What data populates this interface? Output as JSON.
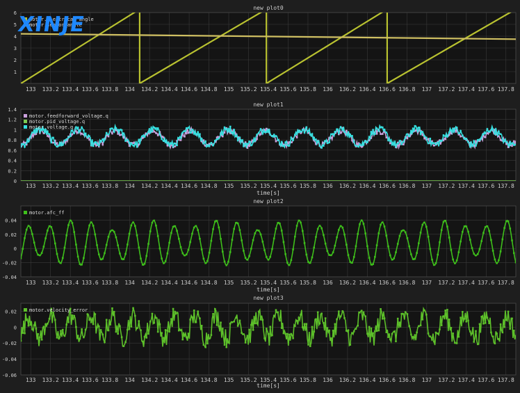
{
  "watermark": "XINJE",
  "colors": {
    "background": "#1e1e1e",
    "plot_bg": "#141414",
    "grid": "#3a3a3a",
    "text": "#cfcfcf",
    "plot0_series": [
      "#b9c230",
      "#cfbf62"
    ],
    "plot1_series": [
      "#c9a0dc",
      "#7dcc52",
      "#36e0e0"
    ],
    "plot2_series": [
      "#3ebf1b"
    ],
    "plot3_series": [
      "#5dc02a"
    ]
  },
  "chart_data": [
    {
      "type": "line",
      "title": "new plot0",
      "xlabel": "",
      "ylabel": "",
      "xlim": [
        132.9,
        137.9
      ],
      "ylim": [
        0,
        6
      ],
      "x_ticks": [
        "133",
        "133.2",
        "133.4",
        "133.6",
        "133.8",
        "134",
        "134.2",
        "134.4",
        "134.6",
        "134.8",
        "135",
        "135.2",
        "135.4",
        "135.6",
        "135.8",
        "136",
        "136.2",
        "136.4",
        "136.6",
        "136.8",
        "137",
        "137.2",
        "137.4",
        "137.6",
        "137.8"
      ],
      "y_ticks": [
        "1",
        "2",
        "3",
        "4",
        "5",
        "6"
      ],
      "grid": true,
      "legend_position": "top-left",
      "series": [
        {
          "name": "motor.electrical_angle",
          "kind": "sawtooth",
          "points": [
            [
              132.9,
              0.0
            ],
            [
              134.1,
              6.28
            ],
            [
              134.1,
              0.0
            ],
            [
              135.38,
              6.28
            ],
            [
              135.38,
              0.0
            ],
            [
              136.6,
              6.28
            ],
            [
              136.6,
              0.0
            ],
            [
              137.9,
              6.28
            ]
          ]
        },
        {
          "name": "motor.sensor_angle",
          "kind": "line",
          "points": [
            [
              132.9,
              4.2
            ],
            [
              137.9,
              3.75
            ]
          ]
        }
      ]
    },
    {
      "type": "line",
      "title": "new plot1",
      "xlabel": "time[s]",
      "ylabel": "",
      "xlim": [
        132.9,
        137.9
      ],
      "ylim": [
        0,
        1.4
      ],
      "x_ticks": [
        "133",
        "133.2",
        "133.4",
        "133.6",
        "133.8",
        "134",
        "134.2",
        "134.4",
        "134.6",
        "134.8",
        "135",
        "135.2",
        "135.4",
        "135.6",
        "135.8",
        "136",
        "136.2",
        "136.4",
        "136.6",
        "136.8",
        "137",
        "137.2",
        "137.4",
        "137.6",
        "137.8"
      ],
      "y_ticks": [
        "0",
        "0.2",
        "0.4",
        "0.6",
        "0.8",
        "1",
        "1.2",
        "1.4"
      ],
      "grid": true,
      "legend_position": "top-left",
      "series": [
        {
          "name": "motor.feedforward_voltage.q",
          "kind": "oscillating",
          "mean": 0.84,
          "amplitude": 0.14,
          "period": 0.38,
          "noise": 0.06
        },
        {
          "name": "motor.pid_voltage.q",
          "kind": "constant",
          "value": 0.0
        },
        {
          "name": "motor.voltage.q",
          "kind": "oscillating",
          "mean": 0.86,
          "amplitude": 0.15,
          "period": 0.38,
          "noise": 0.07
        }
      ]
    },
    {
      "type": "line",
      "title": "new plot2",
      "xlabel": "time[s]",
      "ylabel": "",
      "xlim": [
        132.9,
        137.9
      ],
      "ylim": [
        -0.04,
        0.06
      ],
      "x_ticks": [
        "133",
        "133.2",
        "133.4",
        "133.6",
        "133.8",
        "134",
        "134.2",
        "134.4",
        "134.6",
        "134.8",
        "135",
        "135.2",
        "135.4",
        "135.6",
        "135.8",
        "136",
        "136.2",
        "136.4",
        "136.6",
        "136.8",
        "137",
        "137.2",
        "137.4",
        "137.6",
        "137.8"
      ],
      "y_ticks": [
        "-0.04",
        "-0.02",
        "0",
        "0.02",
        "0.04"
      ],
      "grid": true,
      "legend_position": "top-left",
      "series": [
        {
          "name": "motor.afc_ff",
          "kind": "oscillating",
          "mean": 0.008,
          "amplitude": 0.032,
          "period": 0.21,
          "envelope_period": 1.25
        }
      ]
    },
    {
      "type": "line",
      "title": "new plot3",
      "xlabel": "time[s]",
      "ylabel": "",
      "xlim": [
        132.9,
        137.9
      ],
      "ylim": [
        -0.06,
        0.03
      ],
      "x_ticks": [
        "133",
        "133.2",
        "133.4",
        "133.6",
        "133.8",
        "134",
        "134.2",
        "134.4",
        "134.6",
        "134.8",
        "135",
        "135.2",
        "135.4",
        "135.6",
        "135.8",
        "136",
        "136.2",
        "136.4",
        "136.6",
        "136.8",
        "137",
        "137.2",
        "137.4",
        "137.6",
        "137.8"
      ],
      "y_ticks": [
        "-0.06",
        "-0.04",
        "-0.02",
        "0",
        "0.02"
      ],
      "grid": true,
      "legend_position": "top-left",
      "series": [
        {
          "name": "motor.velocity_error",
          "kind": "noisy",
          "mean": 0.0,
          "amplitude": 0.014,
          "period": 0.21,
          "noise": 0.012
        }
      ]
    }
  ]
}
